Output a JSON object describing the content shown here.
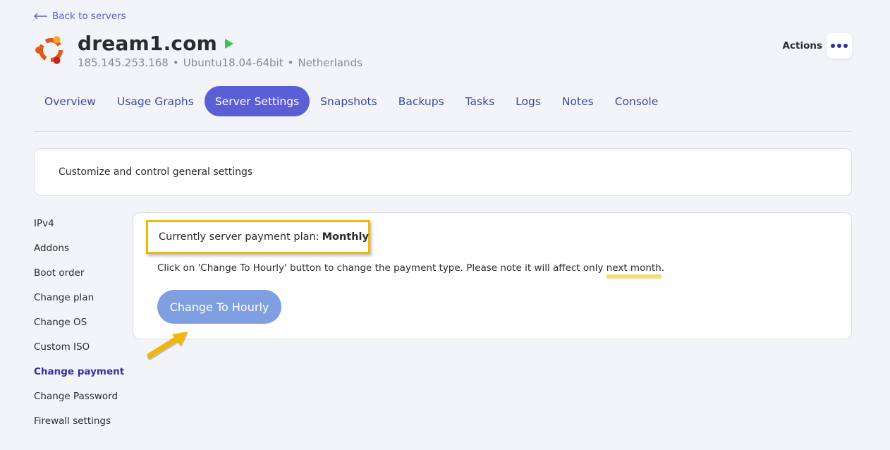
{
  "nav": {
    "back_label": "Back to servers"
  },
  "server": {
    "name": "dream1.com",
    "ip": "185.145.253.168",
    "os": "Ubuntu18.04-64bit",
    "location": "Netherlands",
    "separator": "•",
    "status": "running"
  },
  "actions": {
    "label": "Actions"
  },
  "tabs": [
    {
      "label": "Overview"
    },
    {
      "label": "Usage Graphs"
    },
    {
      "label": "Server Settings",
      "active": true
    },
    {
      "label": "Snapshots"
    },
    {
      "label": "Backups"
    },
    {
      "label": "Tasks"
    },
    {
      "label": "Logs"
    },
    {
      "label": "Notes"
    },
    {
      "label": "Console"
    }
  ],
  "intro": {
    "text": "Customize and control general settings"
  },
  "sidenav": [
    {
      "label": "IPv4"
    },
    {
      "label": "Addons"
    },
    {
      "label": "Boot order"
    },
    {
      "label": "Change plan"
    },
    {
      "label": "Change OS"
    },
    {
      "label": "Custom ISO"
    },
    {
      "label": "Change payment",
      "active": true
    },
    {
      "label": "Change Password"
    },
    {
      "label": "Firewall settings"
    }
  ],
  "payment": {
    "plan_label": "Currently server payment plan:",
    "plan_value": "Monthly",
    "note_prefix": "Click on 'Change To Hourly' button to change the payment type. Please note it will affect only",
    "note_highlight": "next month",
    "note_suffix": ".",
    "button_label": "Change To Hourly"
  },
  "colors": {
    "accent": "#5b5fd6",
    "tab_text": "#3a4a9a",
    "active_sidenav": "#2e32a8",
    "button": "#7f9fe0",
    "annotation": "#f2b705",
    "status_running": "#3cc24a"
  },
  "icons": {
    "back": "arrow-left-icon",
    "logo": "ubuntu-logo-icon",
    "status": "play-icon",
    "actions": "more-horizontal-icon",
    "annotation": "arrow-annotation-icon"
  }
}
